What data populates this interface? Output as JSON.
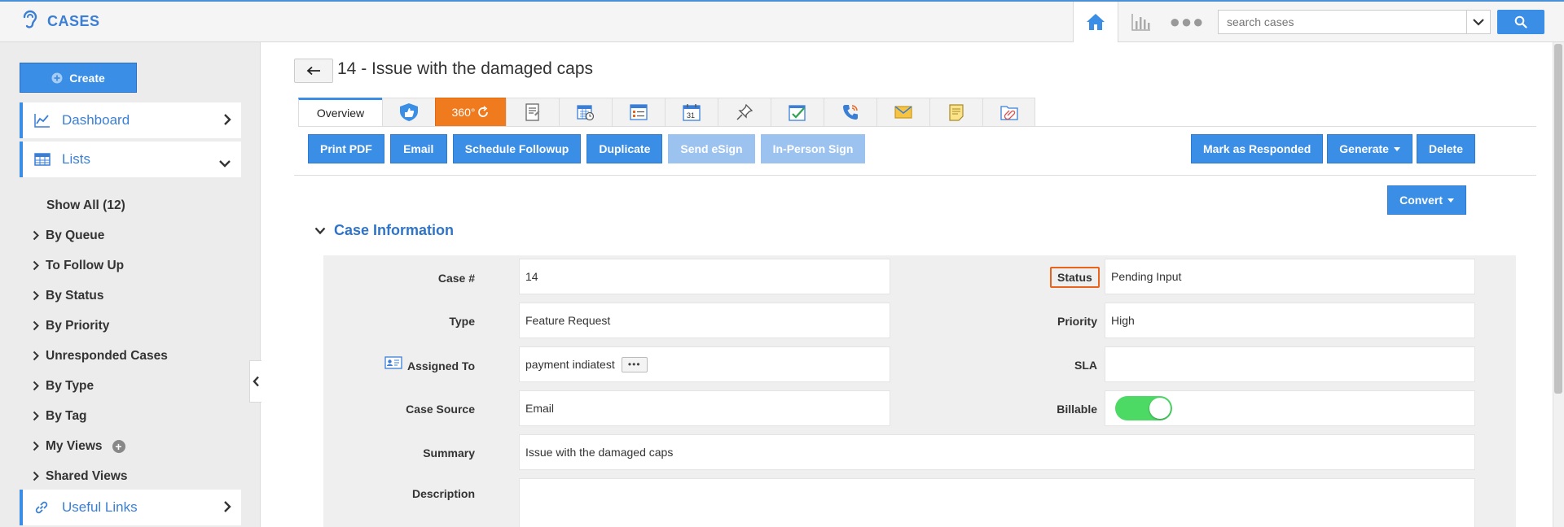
{
  "app": {
    "title": "CASES"
  },
  "search": {
    "placeholder": "search cases"
  },
  "sidebar": {
    "create_label": "Create",
    "dashboard_label": "Dashboard",
    "lists_label": "Lists",
    "list_items": [
      "Show All (12)",
      "By Queue",
      "To Follow Up",
      "By Status",
      "By Priority",
      "Unresponded Cases",
      "By Type",
      "By Tag",
      "My Views",
      "Shared Views"
    ],
    "useful_links_label": "Useful Links"
  },
  "page": {
    "title": "14 - Issue with the damaged caps"
  },
  "tabs": {
    "overview": "Overview",
    "three60": "360°"
  },
  "actions": {
    "print_pdf": "Print PDF",
    "email": "Email",
    "schedule_followup": "Schedule Followup",
    "duplicate": "Duplicate",
    "send_esign": "Send eSign",
    "in_person_sign": "In-Person Sign",
    "mark_responded": "Mark as Responded",
    "generate": "Generate",
    "delete": "Delete",
    "convert": "Convert"
  },
  "section": {
    "title": "Case Information"
  },
  "fields": {
    "case_no": {
      "label": "Case #",
      "value": "14"
    },
    "status": {
      "label": "Status",
      "value": "Pending Input"
    },
    "type": {
      "label": "Type",
      "value": "Feature Request"
    },
    "priority": {
      "label": "Priority",
      "value": "High"
    },
    "assigned_to": {
      "label": "Assigned To",
      "value": "payment indiatest"
    },
    "sla": {
      "label": "SLA",
      "value": ""
    },
    "case_source": {
      "label": "Case Source",
      "value": "Email"
    },
    "billable": {
      "label": "Billable",
      "value": "on"
    },
    "summary": {
      "label": "Summary",
      "value": "Issue with the damaged caps"
    },
    "description": {
      "label": "Description",
      "value": ""
    }
  },
  "colors": {
    "accent": "#3a8ee6",
    "orange": "#f07a1e",
    "toggle_on": "#4cd964"
  }
}
